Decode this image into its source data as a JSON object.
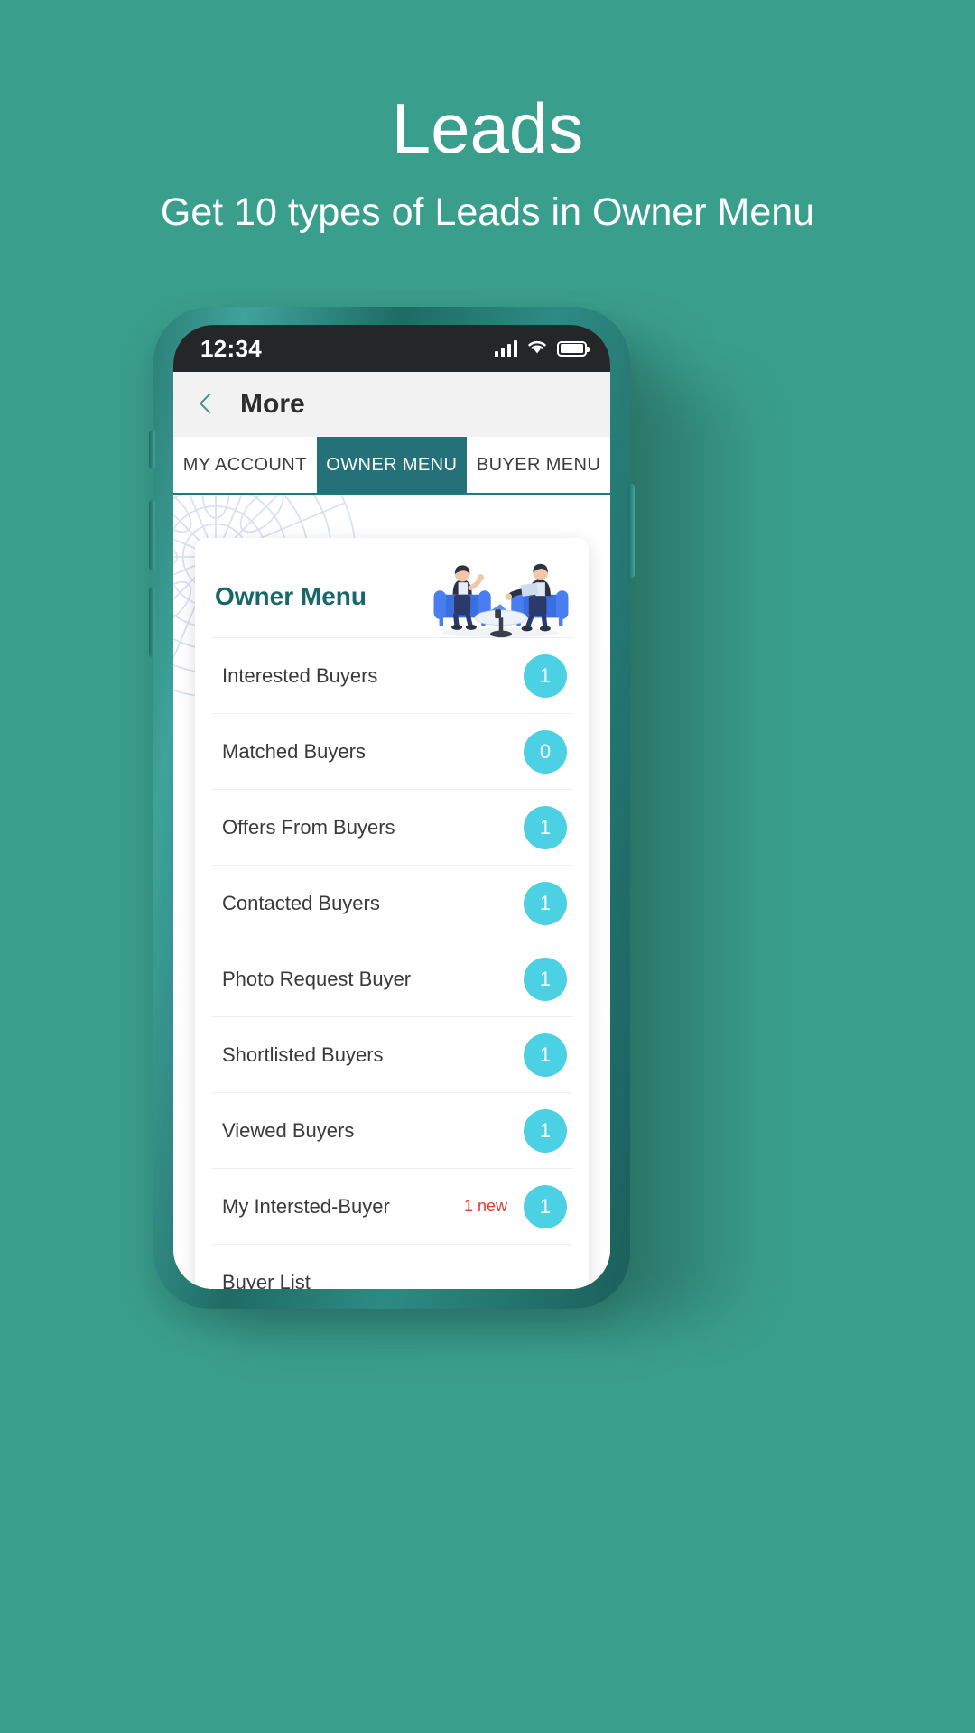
{
  "promo": {
    "title": "Leads",
    "subtitle": "Get 10 types of Leads in Owner Menu"
  },
  "theme": {
    "background": "#3a9e8d",
    "tab_active": "#257179",
    "badge": "#4cd0e3",
    "card_title": "#18686b",
    "new_label": "#e5392f"
  },
  "phone": {
    "statusbar": {
      "time": "12:34",
      "icons": [
        "signal-icon",
        "wifi-icon",
        "battery-icon"
      ]
    },
    "appbar": {
      "back_icon": "chevron-left-icon",
      "title": "More"
    },
    "tabs": [
      {
        "label": "MY ACCOUNT",
        "active": false
      },
      {
        "label": "OWNER MENU",
        "active": true
      },
      {
        "label": "BUYER MENU",
        "active": false
      }
    ],
    "card": {
      "title": "Owner Menu",
      "illustration": "two-people-meeting-illustration",
      "rows": [
        {
          "label": "Interested Buyers",
          "new": "",
          "count": "1"
        },
        {
          "label": "Matched Buyers",
          "new": "",
          "count": "0"
        },
        {
          "label": "Offers From Buyers",
          "new": "",
          "count": "1"
        },
        {
          "label": "Contacted Buyers",
          "new": "",
          "count": "1"
        },
        {
          "label": "Photo Request Buyer",
          "new": "",
          "count": "1"
        },
        {
          "label": "Shortlisted Buyers",
          "new": "",
          "count": "1"
        },
        {
          "label": "Viewed Buyers",
          "new": "",
          "count": "1"
        },
        {
          "label": "My Intersted-Buyer",
          "new": "1 new",
          "count": "1"
        },
        {
          "label": "Buyer List",
          "new": "",
          "count": ""
        }
      ]
    }
  }
}
